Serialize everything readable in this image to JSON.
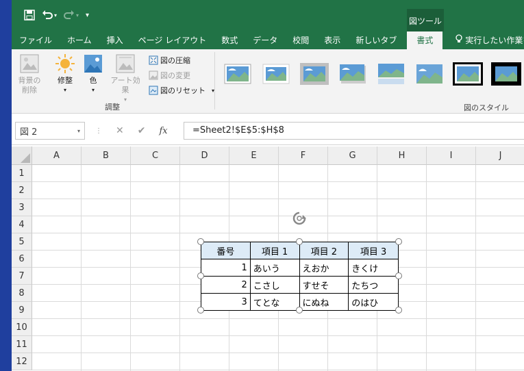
{
  "qat": {
    "more": "▾"
  },
  "titlebar": {
    "context_tab": "図ツール"
  },
  "tabs": [
    {
      "label": "ファイル"
    },
    {
      "label": "ホーム"
    },
    {
      "label": "挿入"
    },
    {
      "label": "ページ レイアウト"
    },
    {
      "label": "数式"
    },
    {
      "label": "データ"
    },
    {
      "label": "校閲"
    },
    {
      "label": "表示"
    },
    {
      "label": "新しいタブ"
    }
  ],
  "active_tab": "書式",
  "tell_me": "実行したい作業を",
  "ribbon": {
    "remove_bg": "背景の\n削除",
    "corrections": "修整",
    "color": "色",
    "artistic": "アート効果",
    "compress": "図の圧縮",
    "change": "図の変更",
    "reset": "図のリセット",
    "adjust_group": "調整",
    "styles_group": "図のスタイル"
  },
  "formula_bar": {
    "name_box": "図 2",
    "formula": "=Sheet2!$E$5:$H$8",
    "fx": "fx",
    "cancel": "✕",
    "enter": "✔"
  },
  "columns": [
    "A",
    "B",
    "C",
    "D",
    "E",
    "F",
    "G",
    "H",
    "I",
    "J"
  ],
  "rows": [
    "1",
    "2",
    "3",
    "4",
    "5",
    "6",
    "7",
    "8",
    "9",
    "10",
    "11",
    "12"
  ],
  "picture_table": {
    "header": [
      "番号",
      "項目 1",
      "項目 2",
      "項目 3"
    ],
    "rows": [
      [
        "1",
        "あいう",
        "えおか",
        "きくけ"
      ],
      [
        "2",
        "こさし",
        "すせそ",
        "たちつ"
      ],
      [
        "3",
        "てとな",
        "にぬね",
        "のはひ"
      ]
    ]
  },
  "colors": {
    "excel_green": "#217346",
    "header_fill": "#ddebf7"
  }
}
